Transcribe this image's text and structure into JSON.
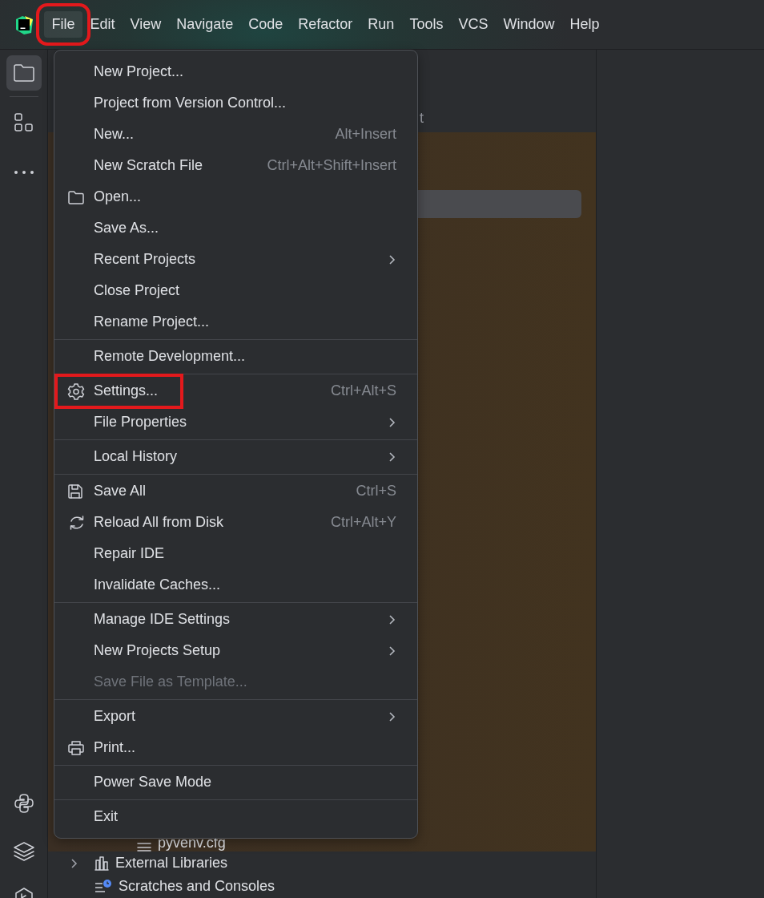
{
  "menu_bar": {
    "items": [
      {
        "label": "File",
        "selected": true,
        "annotated": true
      },
      {
        "label": "Edit",
        "selected": false,
        "annotated": false
      },
      {
        "label": "View",
        "selected": false,
        "annotated": false
      },
      {
        "label": "Navigate",
        "selected": false,
        "annotated": false
      },
      {
        "label": "Code",
        "selected": false,
        "annotated": false
      },
      {
        "label": "Refactor",
        "selected": false,
        "annotated": false
      },
      {
        "label": "Run",
        "selected": false,
        "annotated": false
      },
      {
        "label": "Tools",
        "selected": false,
        "annotated": false
      },
      {
        "label": "VCS",
        "selected": false,
        "annotated": false
      },
      {
        "label": "Window",
        "selected": false,
        "annotated": false
      },
      {
        "label": "Help",
        "selected": false,
        "annotated": false
      }
    ]
  },
  "tool_buttons_top": [
    {
      "kind": "project",
      "selected": true
    },
    {
      "kind": "structure",
      "selected": false
    },
    {
      "kind": "more",
      "selected": false
    }
  ],
  "tool_buttons_bottom": [
    {
      "kind": "python",
      "selected": false
    },
    {
      "kind": "layers",
      "selected": false
    },
    {
      "kind": "run",
      "selected": false
    }
  ],
  "project_panel": {
    "tab_label": "t",
    "rows": [
      {
        "kind": "file",
        "label": "pyvenv.cfg"
      },
      {
        "kind": "libraries",
        "label": "External Libraries",
        "expanded": false
      },
      {
        "kind": "scratches",
        "label": "Scratches and Consoles"
      }
    ]
  },
  "file_menu": {
    "items": [
      {
        "kind": "item",
        "label": "New Project...",
        "submenu": false,
        "disabled": false,
        "annotated": false
      },
      {
        "kind": "item",
        "label": "Project from Version Control...",
        "submenu": false,
        "disabled": false,
        "annotated": false
      },
      {
        "kind": "item",
        "label": "New...",
        "shortcut": "Alt+Insert",
        "submenu": false,
        "disabled": false,
        "annotated": false
      },
      {
        "kind": "item",
        "label": "New Scratch File",
        "shortcut": "Ctrl+Alt+Shift+Insert",
        "submenu": false,
        "disabled": false,
        "annotated": false
      },
      {
        "kind": "item",
        "label": "Open...",
        "submenu": false,
        "disabled": false,
        "annotated": false
      },
      {
        "kind": "item",
        "label": "Save As...",
        "submenu": false,
        "disabled": false,
        "annotated": false
      },
      {
        "kind": "item",
        "label": "Recent Projects",
        "submenu": true,
        "disabled": false,
        "annotated": false
      },
      {
        "kind": "item",
        "label": "Close Project",
        "submenu": false,
        "disabled": false,
        "annotated": false
      },
      {
        "kind": "item",
        "label": "Rename Project...",
        "submenu": false,
        "disabled": false,
        "annotated": false
      },
      {
        "kind": "separator"
      },
      {
        "kind": "item",
        "label": "Remote Development...",
        "submenu": false,
        "disabled": false,
        "annotated": false
      },
      {
        "kind": "separator"
      },
      {
        "kind": "item",
        "label": "Settings...",
        "shortcut": "Ctrl+Alt+S",
        "submenu": false,
        "disabled": false,
        "annotated": true
      },
      {
        "kind": "item",
        "label": "File Properties",
        "submenu": true,
        "disabled": false,
        "annotated": false
      },
      {
        "kind": "separator"
      },
      {
        "kind": "item",
        "label": "Local History",
        "submenu": true,
        "disabled": false,
        "annotated": false
      },
      {
        "kind": "separator"
      },
      {
        "kind": "item",
        "label": "Save All",
        "shortcut": "Ctrl+S",
        "submenu": false,
        "disabled": false,
        "annotated": false
      },
      {
        "kind": "item",
        "label": "Reload All from Disk",
        "shortcut": "Ctrl+Alt+Y",
        "submenu": false,
        "disabled": false,
        "annotated": false
      },
      {
        "kind": "item",
        "label": "Repair IDE",
        "submenu": false,
        "disabled": false,
        "annotated": false
      },
      {
        "kind": "item",
        "label": "Invalidate Caches...",
        "submenu": false,
        "disabled": false,
        "annotated": false
      },
      {
        "kind": "separator"
      },
      {
        "kind": "item",
        "label": "Manage IDE Settings",
        "submenu": true,
        "disabled": false,
        "annotated": false
      },
      {
        "kind": "item",
        "label": "New Projects Setup",
        "submenu": true,
        "disabled": false,
        "annotated": false
      },
      {
        "kind": "item",
        "label": "Save File as Template...",
        "submenu": false,
        "disabled": true,
        "annotated": false
      },
      {
        "kind": "separator"
      },
      {
        "kind": "item",
        "label": "Export",
        "submenu": true,
        "disabled": false,
        "annotated": false
      },
      {
        "kind": "item",
        "label": "Print...",
        "submenu": false,
        "disabled": false,
        "annotated": false
      },
      {
        "kind": "separator"
      },
      {
        "kind": "item",
        "label": "Power Save Mode",
        "submenu": false,
        "disabled": false,
        "annotated": false
      },
      {
        "kind": "separator"
      },
      {
        "kind": "item",
        "label": "Exit",
        "submenu": false,
        "disabled": false,
        "annotated": false
      }
    ]
  }
}
